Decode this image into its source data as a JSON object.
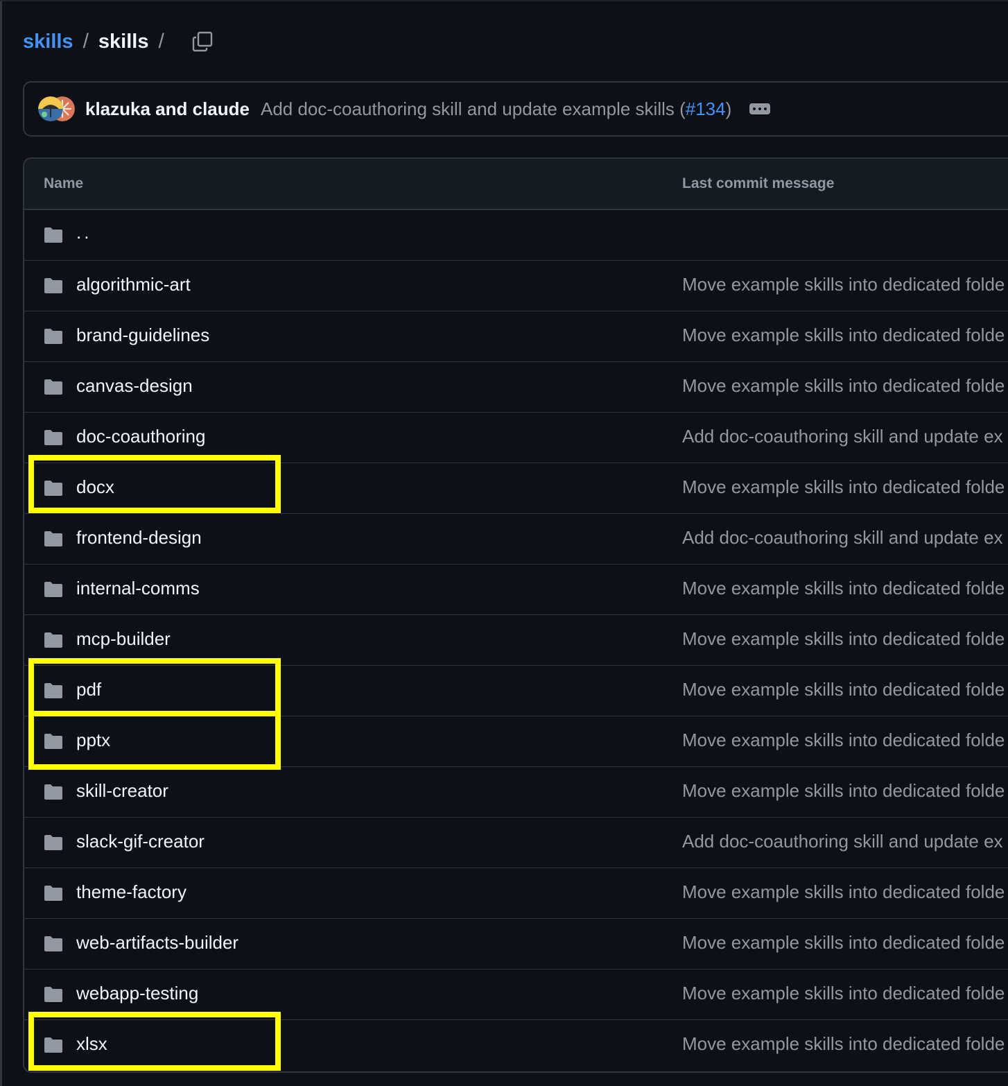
{
  "breadcrumb": {
    "repo": "skills",
    "separator": "/",
    "current": "skills",
    "trailing_separator": "/"
  },
  "commit": {
    "authors": "klazuka and claude",
    "message": "Add doc-coauthoring skill and update example skills (",
    "pr": "#134",
    "message_end": ")"
  },
  "table": {
    "columns": [
      "Name",
      "Last commit message"
    ],
    "parent_dir": "..",
    "rows": [
      {
        "name": "algorithmic-art",
        "message": "Move example skills into dedicated folde"
      },
      {
        "name": "brand-guidelines",
        "message": "Move example skills into dedicated folde"
      },
      {
        "name": "canvas-design",
        "message": "Move example skills into dedicated folde"
      },
      {
        "name": "doc-coauthoring",
        "message": "Add doc-coauthoring skill and update ex"
      },
      {
        "name": "docx",
        "message": "Move example skills into dedicated folde"
      },
      {
        "name": "frontend-design",
        "message": "Add doc-coauthoring skill and update ex"
      },
      {
        "name": "internal-comms",
        "message": "Move example skills into dedicated folde"
      },
      {
        "name": "mcp-builder",
        "message": "Move example skills into dedicated folde"
      },
      {
        "name": "pdf",
        "message": "Move example skills into dedicated folde"
      },
      {
        "name": "pptx",
        "message": "Move example skills into dedicated folde"
      },
      {
        "name": "skill-creator",
        "message": "Move example skills into dedicated folde"
      },
      {
        "name": "slack-gif-creator",
        "message": "Add doc-coauthoring skill and update ex"
      },
      {
        "name": "theme-factory",
        "message": "Move example skills into dedicated folde"
      },
      {
        "name": "web-artifacts-builder",
        "message": "Move example skills into dedicated folde"
      },
      {
        "name": "webapp-testing",
        "message": "Move example skills into dedicated folde"
      },
      {
        "name": "xlsx",
        "message": "Move example skills into dedicated folde"
      }
    ]
  },
  "icons": {
    "folder": "folder-icon",
    "copy": "copy-icon",
    "ellipsis": "ellipsis-icon"
  },
  "colors": {
    "background": "#0d1117",
    "link": "#4493f8",
    "muted": "#9198a1",
    "border": "#30363d",
    "highlight": "#ffff00"
  }
}
